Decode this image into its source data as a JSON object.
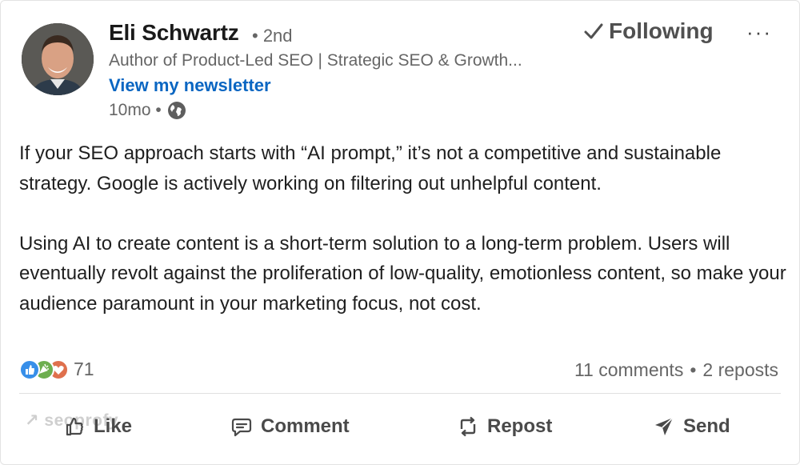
{
  "post": {
    "author": {
      "name": "Eli Schwartz",
      "degree": "• 2nd",
      "headline": "Author of Product-Led SEO | Strategic SEO & Growth...",
      "newsletter_link": "View my newsletter",
      "time": "10mo •",
      "visibility_icon": "globe-icon"
    },
    "follow_label": "Following",
    "follow_icon": "check-icon",
    "more_label": "···",
    "body": [
      "If your SEO approach starts with “AI prompt,” it’s not a competitive and sustainable strategy. Google is actively working on filtering out unhelpful content.",
      "Using AI to create content is a short-term solution to a long-term problem. Users will eventually revolt against the proliferation of low-quality, emotionless content, so make your audience paramount in your marketing focus, not cost."
    ],
    "reactions": {
      "icons": [
        "like-reaction-icon",
        "celebrate-reaction-icon",
        "love-reaction-icon"
      ],
      "count": "71"
    },
    "comments_label": "11 comments",
    "separator": "•",
    "reposts_label": "2 reposts",
    "watermark": "↗ seoprofy",
    "actions": {
      "like": "Like",
      "comment": "Comment",
      "repost": "Repost",
      "send": "Send"
    },
    "colors": {
      "link": "#0a66c2",
      "secondary_text": "#666666",
      "like_blue": "#378fe9",
      "celebrate_green": "#44712e",
      "love_red": "#df704d"
    }
  }
}
